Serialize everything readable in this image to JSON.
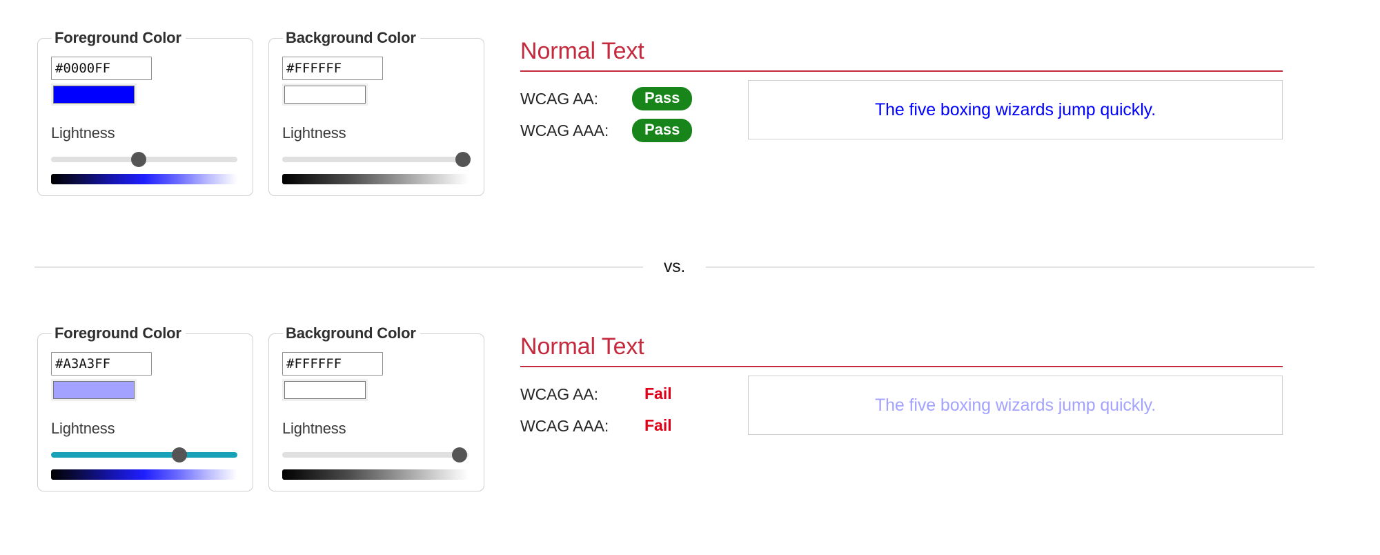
{
  "comparisons": [
    {
      "foreground": {
        "legend": "Foreground Color",
        "hex": "#0000FF",
        "swatch_color": "#0000FF",
        "lightness_label": "Lightness",
        "slider_percent": 47,
        "slider_active": false,
        "gradient": "black-to-blue-to-white"
      },
      "background": {
        "legend": "Background Color",
        "hex": "#FFFFFF",
        "swatch_color": "#FFFFFF",
        "lightness_label": "Lightness",
        "slider_percent": 97,
        "slider_active": false,
        "gradient": "black-to-white"
      },
      "results": {
        "title": "Normal Text",
        "criteria": [
          {
            "label": "WCAG AA:",
            "verdict": "Pass",
            "state": "pass"
          },
          {
            "label": "WCAG AAA:",
            "verdict": "Pass",
            "state": "pass"
          }
        ],
        "sample_text": "The five boxing wizards jump quickly.",
        "sample_text_color": "#0000FF",
        "sample_bg_color": "#FFFFFF"
      }
    },
    {
      "foreground": {
        "legend": "Foreground Color",
        "hex": "#A3A3FF",
        "swatch_color": "#A3A3FF",
        "lightness_label": "Lightness",
        "slider_percent": 69,
        "slider_active": true,
        "gradient": "black-to-blue-to-white"
      },
      "background": {
        "legend": "Background Color",
        "hex": "#FFFFFF",
        "swatch_color": "#FFFFFF",
        "lightness_label": "Lightness",
        "slider_percent": 95,
        "slider_active": false,
        "gradient": "black-to-white"
      },
      "results": {
        "title": "Normal Text",
        "criteria": [
          {
            "label": "WCAG AA:",
            "verdict": "Fail",
            "state": "fail"
          },
          {
            "label": "WCAG AAA:",
            "verdict": "Fail",
            "state": "fail"
          }
        ],
        "sample_text": "The five boxing wizards jump quickly.",
        "sample_text_color": "#A3A3FF",
        "sample_bg_color": "#FFFFFF"
      }
    }
  ],
  "divider": {
    "label": "vs."
  },
  "colors": {
    "pass_badge": "#17851a",
    "fail_text": "#e00018",
    "heading": "#c4293d",
    "slider_active_track": "#17a2b8"
  }
}
